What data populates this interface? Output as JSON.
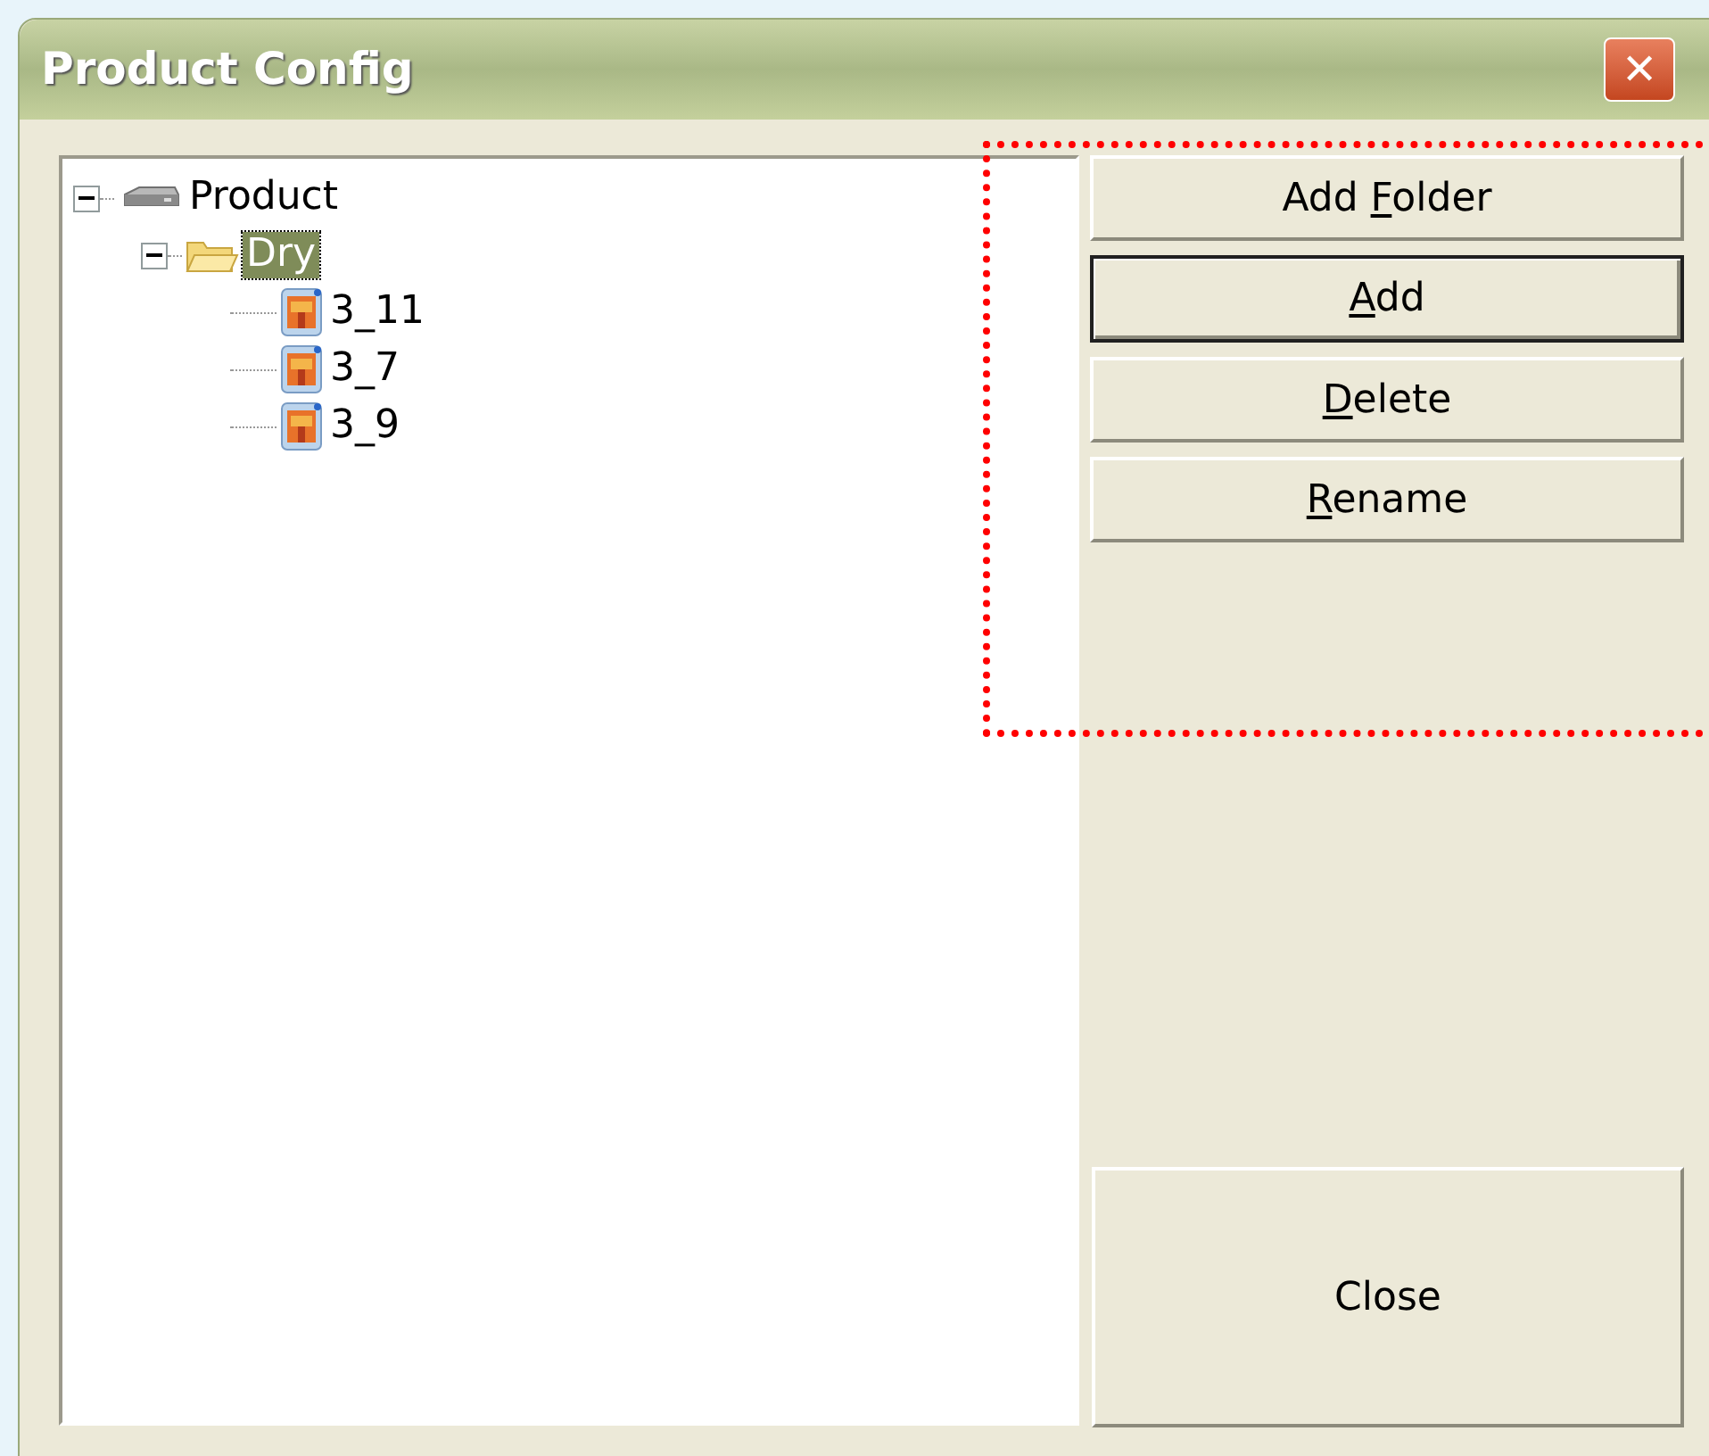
{
  "window": {
    "title": "Product Config",
    "close_glyph": "✕"
  },
  "tree": [
    {
      "label": "Product",
      "kind": "device",
      "expanded": true,
      "selected": false,
      "children": [
        {
          "label": "Dry",
          "kind": "folder",
          "expanded": true,
          "selected": true,
          "children": [
            {
              "label": "3_11",
              "kind": "item",
              "selected": false
            },
            {
              "label": "3_7",
              "kind": "item",
              "selected": false
            },
            {
              "label": "3_9",
              "kind": "item",
              "selected": false
            }
          ]
        }
      ]
    }
  ],
  "buttons": [
    {
      "label_before": "Add ",
      "mnemonic": "F",
      "label_after": "older",
      "default": false
    },
    {
      "mnemonic": "A",
      "label_after": "dd",
      "default": true
    },
    {
      "mnemonic": "D",
      "label_after": "elete",
      "default": false
    },
    {
      "mnemonic": "R",
      "label_after": "ename",
      "default": false
    }
  ],
  "close_button": {
    "label": "Close"
  }
}
